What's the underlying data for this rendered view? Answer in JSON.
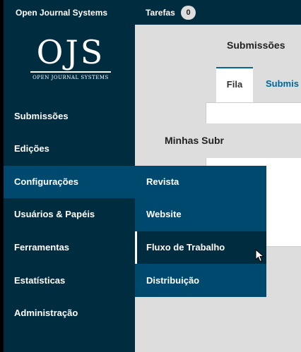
{
  "topbar": {
    "site_name": "Open Journal Systems",
    "tasks_label": "Tarefas",
    "tasks_count": "0"
  },
  "logo": {
    "main": "OJS",
    "sub": "OPEN JOURNAL SYSTEMS"
  },
  "sidebar": {
    "items": [
      {
        "label": "Submissões"
      },
      {
        "label": "Edições"
      },
      {
        "label": "Configurações"
      },
      {
        "label": "Usuários & Papéis"
      },
      {
        "label": "Ferramentas"
      },
      {
        "label": "Estatísticas"
      },
      {
        "label": "Administração"
      }
    ]
  },
  "main": {
    "title": "Submissões",
    "tabs": [
      {
        "label": "Fila"
      },
      {
        "label": "Submis"
      }
    ],
    "panel_heading": "Minhas Subr"
  },
  "submenu": {
    "items": [
      {
        "label": "Revista"
      },
      {
        "label": "Website"
      },
      {
        "label": "Fluxo de Trabalho"
      },
      {
        "label": "Distribuição"
      }
    ]
  },
  "colors": {
    "dark": "#002c40",
    "accent": "#00496e",
    "link": "#006798"
  }
}
